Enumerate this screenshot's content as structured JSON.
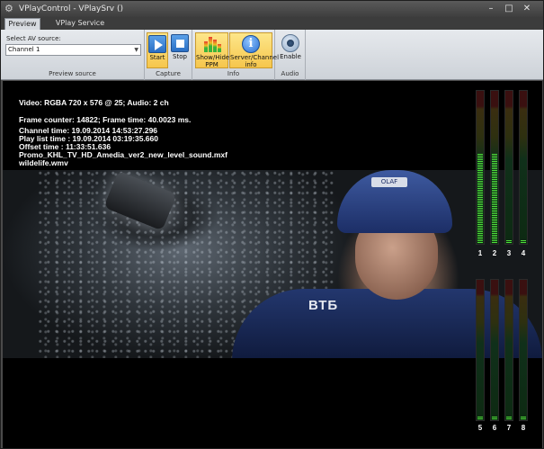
{
  "window": {
    "title": "VPlayControl - VPlaySrv ()",
    "controls": {
      "minimize": "–",
      "maximize": "□",
      "close": "✕"
    }
  },
  "tabs": [
    {
      "label": "Preview",
      "active": true
    },
    {
      "label": "VPlay Service Control",
      "active": false
    }
  ],
  "ribbon": {
    "source": {
      "label": "Select AV source:",
      "selected": "Channel 1",
      "caption": "Preview source"
    },
    "capture": {
      "start_label": "Start",
      "stop_label": "Stop",
      "caption": "Capture"
    },
    "info": {
      "ppm_label_1": "Show/Hide",
      "ppm_label_2": "PPM",
      "server_label_1": "Server/Channel",
      "server_label_2": "info",
      "caption": "Info"
    },
    "audio": {
      "enable_label": "Enable",
      "caption": "Audio"
    }
  },
  "overlay": {
    "video_info": "Video: RGBA 720 x 576 @ 25; Audio: 2 ch",
    "frame_info": "Frame counter: 14822; Frame time: 40.0023 ms.",
    "channel_time": "Channel time: 19.09.2014 14:53:27.296",
    "playlist_time": "Play list time : 19.09.2014 03:19:35.660",
    "offset_time": "Offset time : 11:33:51.636",
    "clip_name": "Promo_KHL_TV_HD_Amedia_ver2_new_level_sound.mxf",
    "next_clip": "wildelife.wmv"
  },
  "jersey_text": "ВТБ",
  "helmet_text": "OLAF",
  "meters": {
    "top": [
      {
        "label": "1",
        "level": 0.58
      },
      {
        "label": "2",
        "level": 0.58
      },
      {
        "label": "3",
        "level": 0.02
      },
      {
        "label": "4",
        "level": 0.02
      }
    ],
    "bottom": [
      {
        "label": "5",
        "level": 0.02
      },
      {
        "label": "6",
        "level": 0.02
      },
      {
        "label": "7",
        "level": 0.02
      },
      {
        "label": "8",
        "level": 0.02
      }
    ]
  },
  "colors": {
    "accent": "#f6c64c",
    "meter_green": "#4fe03a",
    "background": "#000000"
  },
  "icons": [
    "app-icon",
    "play-icon",
    "stop-icon",
    "ppm-icon",
    "info-icon",
    "speaker-icon"
  ]
}
